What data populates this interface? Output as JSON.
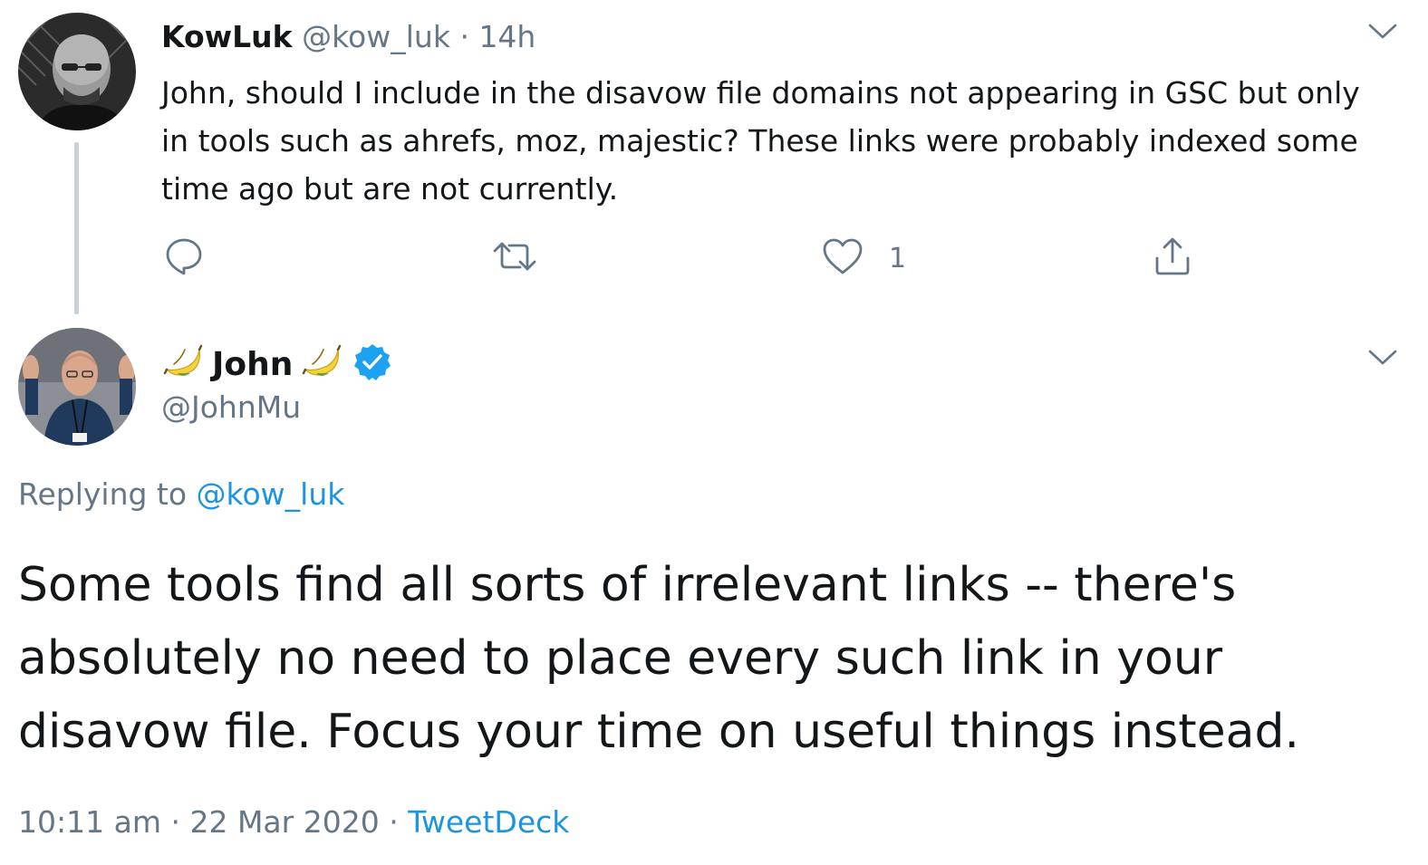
{
  "parent_tweet": {
    "display_name": "KowLuk",
    "handle": "@kow_luk",
    "separator": "·",
    "time_ago": "14h",
    "text": "John, should I include in the disavow file domains not appearing in GSC but only in tools such as ahrefs, moz, majestic? These links were probably indexed some time ago but are not currently.",
    "likes_count": "1",
    "icons": [
      "reply-icon",
      "retweet-icon",
      "like-icon",
      "share-icon",
      "chevron-down-icon"
    ]
  },
  "reply_tweet": {
    "display_name": "John",
    "name_emoji": "banana-icon",
    "verified": true,
    "handle": "@JohnMu",
    "replying_prefix": "Replying to",
    "replying_to": "@kow_luk",
    "text": "Some tools find all sorts of irrelevant links -- there's absolutely no need to place every such link in your disavow file. Focus your time on useful things instead.",
    "time": "10:11 am",
    "separator": "·",
    "date": "22 Mar 2020",
    "source": "TweetDeck"
  },
  "colors": {
    "text": "#14171a",
    "muted": "#657786",
    "link": "#1b95e0",
    "verified": "#1da1f2",
    "thread_line": "#c8d1d8"
  }
}
